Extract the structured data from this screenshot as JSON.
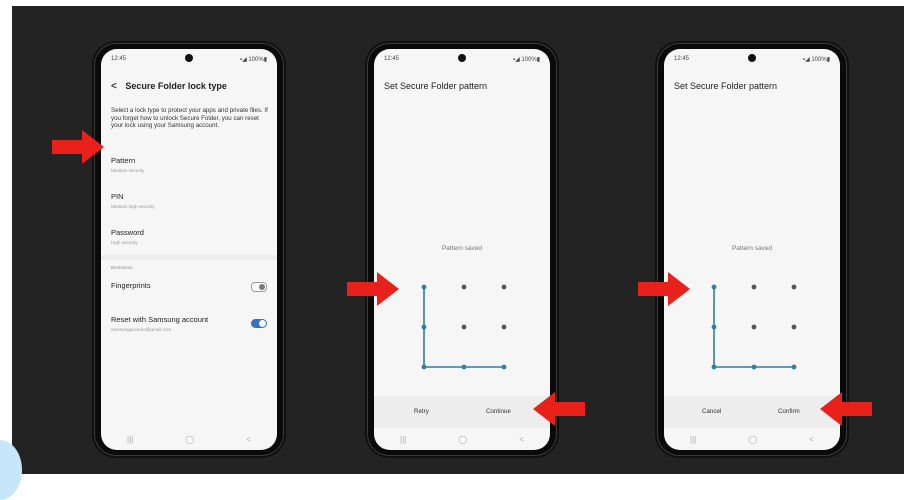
{
  "phones": [
    {
      "status": {
        "time": "12:45",
        "icons": "▪◢ 100%▮"
      },
      "header": {
        "back": "<",
        "title": "Secure Folder lock type"
      },
      "description": "Select a lock type to protect your apps and private files. If you forget how to unlock Secure Folder, you can reset your lock using your Samsung account.",
      "options": [
        {
          "title": "Pattern",
          "subtitle": "Medium security"
        },
        {
          "title": "PIN",
          "subtitle": "Medium-high security"
        },
        {
          "title": "Password",
          "subtitle": "High security"
        }
      ],
      "biometrics_section": "Biometrics",
      "fingerprints": {
        "label": "Fingerprints",
        "enabled": false
      },
      "reset": {
        "label": "Reset with Samsung account",
        "email": "samsungaccount@gmail.com",
        "enabled": true
      },
      "nav": {
        "recent": "|||",
        "home": "◯",
        "back": "<"
      }
    },
    {
      "status": {
        "time": "12:45",
        "icons": "▪◢ 100%▮"
      },
      "header": {
        "title": "Set Secure Folder pattern"
      },
      "pattern_label": "Pattern saved",
      "buttons": {
        "left": "Retry",
        "right": "Continue"
      },
      "nav": {
        "recent": "|||",
        "home": "◯",
        "back": "<"
      }
    },
    {
      "status": {
        "time": "12:45",
        "icons": "▪◢ 100%▮"
      },
      "header": {
        "title": "Set Secure Folder pattern"
      },
      "pattern_label": "Pattern saved",
      "buttons": {
        "left": "Cancel",
        "right": "Confirm"
      },
      "nav": {
        "recent": "|||",
        "home": "◯",
        "back": "<"
      }
    }
  ],
  "colors": {
    "arrow": "#e8221b",
    "toggle_on": "#3a6fc9",
    "pattern_line": "#2f7f9e",
    "background": "#232323"
  }
}
